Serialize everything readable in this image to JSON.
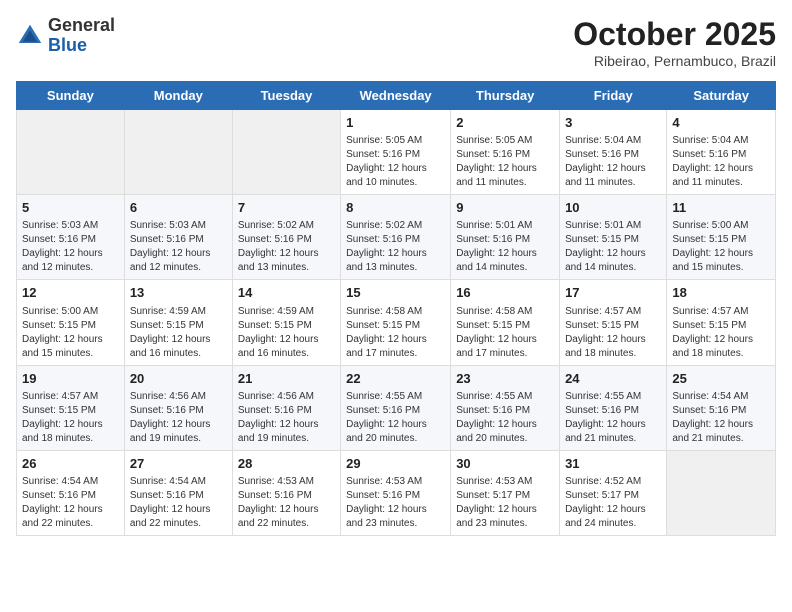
{
  "header": {
    "logo_general": "General",
    "logo_blue": "Blue",
    "month": "October 2025",
    "location": "Ribeirao, Pernambuco, Brazil"
  },
  "weekdays": [
    "Sunday",
    "Monday",
    "Tuesday",
    "Wednesday",
    "Thursday",
    "Friday",
    "Saturday"
  ],
  "weeks": [
    [
      {
        "day": "",
        "info": ""
      },
      {
        "day": "",
        "info": ""
      },
      {
        "day": "",
        "info": ""
      },
      {
        "day": "1",
        "info": "Sunrise: 5:05 AM\nSunset: 5:16 PM\nDaylight: 12 hours and 10 minutes."
      },
      {
        "day": "2",
        "info": "Sunrise: 5:05 AM\nSunset: 5:16 PM\nDaylight: 12 hours and 11 minutes."
      },
      {
        "day": "3",
        "info": "Sunrise: 5:04 AM\nSunset: 5:16 PM\nDaylight: 12 hours and 11 minutes."
      },
      {
        "day": "4",
        "info": "Sunrise: 5:04 AM\nSunset: 5:16 PM\nDaylight: 12 hours and 11 minutes."
      }
    ],
    [
      {
        "day": "5",
        "info": "Sunrise: 5:03 AM\nSunset: 5:16 PM\nDaylight: 12 hours and 12 minutes."
      },
      {
        "day": "6",
        "info": "Sunrise: 5:03 AM\nSunset: 5:16 PM\nDaylight: 12 hours and 12 minutes."
      },
      {
        "day": "7",
        "info": "Sunrise: 5:02 AM\nSunset: 5:16 PM\nDaylight: 12 hours and 13 minutes."
      },
      {
        "day": "8",
        "info": "Sunrise: 5:02 AM\nSunset: 5:16 PM\nDaylight: 12 hours and 13 minutes."
      },
      {
        "day": "9",
        "info": "Sunrise: 5:01 AM\nSunset: 5:16 PM\nDaylight: 12 hours and 14 minutes."
      },
      {
        "day": "10",
        "info": "Sunrise: 5:01 AM\nSunset: 5:15 PM\nDaylight: 12 hours and 14 minutes."
      },
      {
        "day": "11",
        "info": "Sunrise: 5:00 AM\nSunset: 5:15 PM\nDaylight: 12 hours and 15 minutes."
      }
    ],
    [
      {
        "day": "12",
        "info": "Sunrise: 5:00 AM\nSunset: 5:15 PM\nDaylight: 12 hours and 15 minutes."
      },
      {
        "day": "13",
        "info": "Sunrise: 4:59 AM\nSunset: 5:15 PM\nDaylight: 12 hours and 16 minutes."
      },
      {
        "day": "14",
        "info": "Sunrise: 4:59 AM\nSunset: 5:15 PM\nDaylight: 12 hours and 16 minutes."
      },
      {
        "day": "15",
        "info": "Sunrise: 4:58 AM\nSunset: 5:15 PM\nDaylight: 12 hours and 17 minutes."
      },
      {
        "day": "16",
        "info": "Sunrise: 4:58 AM\nSunset: 5:15 PM\nDaylight: 12 hours and 17 minutes."
      },
      {
        "day": "17",
        "info": "Sunrise: 4:57 AM\nSunset: 5:15 PM\nDaylight: 12 hours and 18 minutes."
      },
      {
        "day": "18",
        "info": "Sunrise: 4:57 AM\nSunset: 5:15 PM\nDaylight: 12 hours and 18 minutes."
      }
    ],
    [
      {
        "day": "19",
        "info": "Sunrise: 4:57 AM\nSunset: 5:15 PM\nDaylight: 12 hours and 18 minutes."
      },
      {
        "day": "20",
        "info": "Sunrise: 4:56 AM\nSunset: 5:16 PM\nDaylight: 12 hours and 19 minutes."
      },
      {
        "day": "21",
        "info": "Sunrise: 4:56 AM\nSunset: 5:16 PM\nDaylight: 12 hours and 19 minutes."
      },
      {
        "day": "22",
        "info": "Sunrise: 4:55 AM\nSunset: 5:16 PM\nDaylight: 12 hours and 20 minutes."
      },
      {
        "day": "23",
        "info": "Sunrise: 4:55 AM\nSunset: 5:16 PM\nDaylight: 12 hours and 20 minutes."
      },
      {
        "day": "24",
        "info": "Sunrise: 4:55 AM\nSunset: 5:16 PM\nDaylight: 12 hours and 21 minutes."
      },
      {
        "day": "25",
        "info": "Sunrise: 4:54 AM\nSunset: 5:16 PM\nDaylight: 12 hours and 21 minutes."
      }
    ],
    [
      {
        "day": "26",
        "info": "Sunrise: 4:54 AM\nSunset: 5:16 PM\nDaylight: 12 hours and 22 minutes."
      },
      {
        "day": "27",
        "info": "Sunrise: 4:54 AM\nSunset: 5:16 PM\nDaylight: 12 hours and 22 minutes."
      },
      {
        "day": "28",
        "info": "Sunrise: 4:53 AM\nSunset: 5:16 PM\nDaylight: 12 hours and 22 minutes."
      },
      {
        "day": "29",
        "info": "Sunrise: 4:53 AM\nSunset: 5:16 PM\nDaylight: 12 hours and 23 minutes."
      },
      {
        "day": "30",
        "info": "Sunrise: 4:53 AM\nSunset: 5:17 PM\nDaylight: 12 hours and 23 minutes."
      },
      {
        "day": "31",
        "info": "Sunrise: 4:52 AM\nSunset: 5:17 PM\nDaylight: 12 hours and 24 minutes."
      },
      {
        "day": "",
        "info": ""
      }
    ]
  ]
}
